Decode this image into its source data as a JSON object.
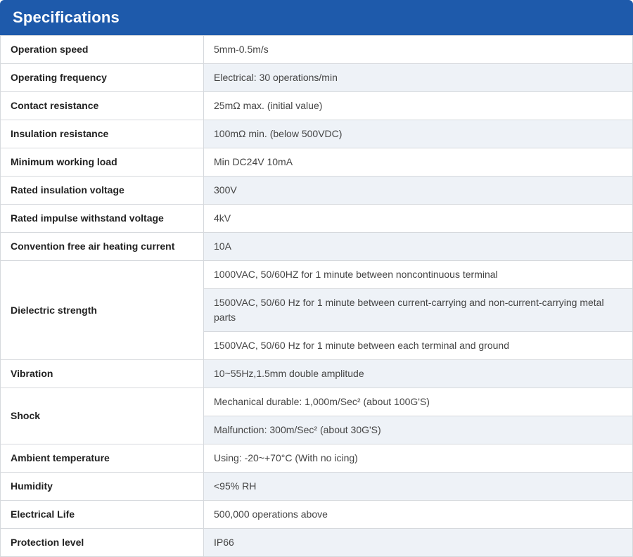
{
  "header": {
    "title": "Specifications"
  },
  "specs": {
    "operation_speed": {
      "label": "Operation speed",
      "value": "5mm-0.5m/s"
    },
    "operating_frequency": {
      "label": "Operating frequency",
      "value": "Electrical: 30 operations/min"
    },
    "contact_resistance": {
      "label": "Contact resistance",
      "value": "25mΩ max. (initial value)"
    },
    "insulation_resistance": {
      "label": "Insulation resistance",
      "value": "100mΩ min. (below 500VDC)"
    },
    "minimum_working_load": {
      "label": "Minimum working load",
      "value": "Min DC24V 10mA"
    },
    "rated_insulation_voltage": {
      "label": "Rated insulation voltage",
      "value": "300V"
    },
    "rated_impulse_withstand_voltage": {
      "label": "Rated impulse withstand voltage",
      "value": "4kV"
    },
    "convention_free_air_heating_current": {
      "label": "Convention free air heating current",
      "value": "10A"
    },
    "dielectric_strength": {
      "label": "Dielectric strength",
      "values": [
        "1000VAC, 50/60HZ for 1 minute between noncontinuous terminal",
        "1500VAC, 50/60 Hz for 1 minute between current-carrying and non-current-carrying metal parts",
        "1500VAC, 50/60 Hz for 1 minute between each terminal and ground"
      ]
    },
    "vibration": {
      "label": "Vibration",
      "value": "10~55Hz,1.5mm double amplitude"
    },
    "shock": {
      "label": "Shock",
      "values": [
        "Mechanical durable: 1,000m/Sec² (about 100G'S)",
        "Malfunction: 300m/Sec² (about 30G'S)"
      ]
    },
    "ambient_temperature": {
      "label": "Ambient temperature",
      "value": "Using: -20~+70°C (With no icing)"
    },
    "humidity": {
      "label": "Humidity",
      "value": "<95% RH"
    },
    "electrical_life": {
      "label": "Electrical Life",
      "value": "500,000 operations above"
    },
    "protection_level": {
      "label": "Protection level",
      "value": "IP66"
    }
  },
  "colors": {
    "header_background": "#1e5aab",
    "header_text": "#ffffff",
    "row_shade": "#eef2f7",
    "border": "#d6d9dd"
  }
}
